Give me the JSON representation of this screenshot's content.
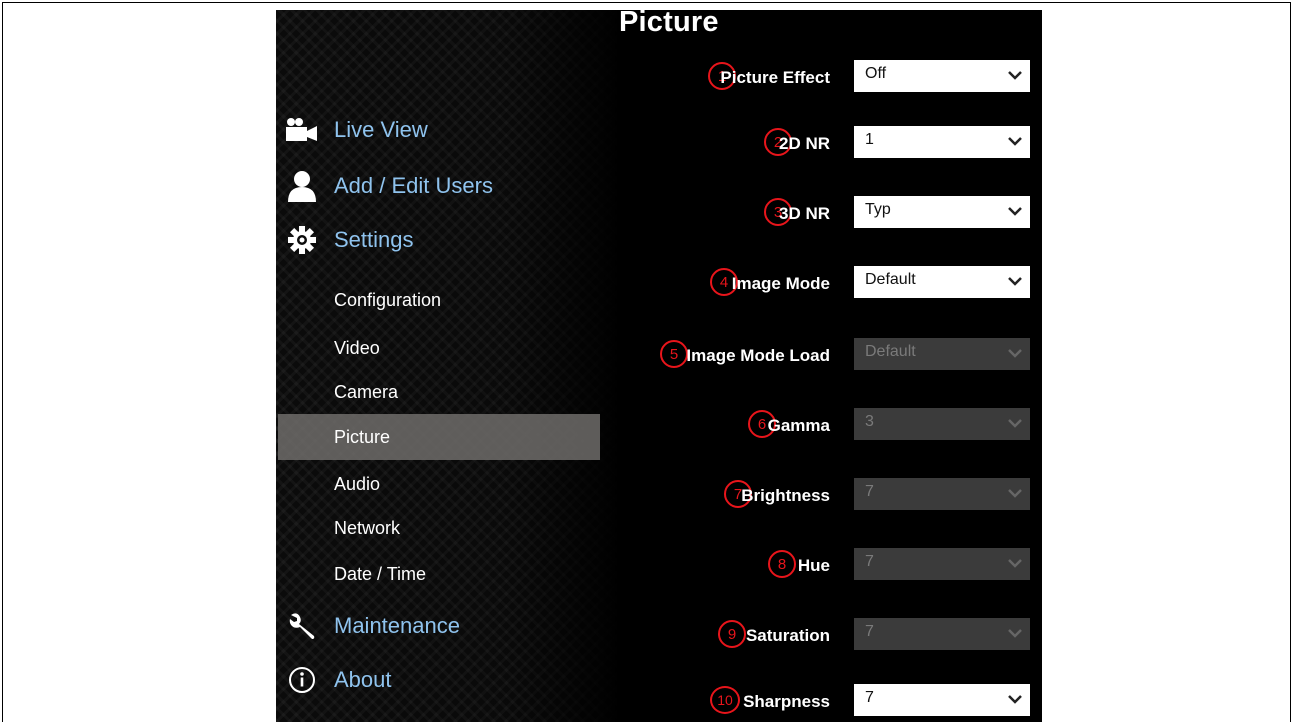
{
  "page": {
    "title": "Picture"
  },
  "nav": {
    "main": [
      {
        "label": "Live View",
        "icon": "video-camera-icon"
      },
      {
        "label": "Add / Edit Users",
        "icon": "user-icon"
      },
      {
        "label": "Settings",
        "icon": "gear-icon"
      },
      {
        "label": "Maintenance",
        "icon": "wrench-icon"
      },
      {
        "label": "About",
        "icon": "info-icon"
      }
    ],
    "settings_sub": [
      {
        "label": "Configuration"
      },
      {
        "label": "Video"
      },
      {
        "label": "Camera"
      },
      {
        "label": "Picture",
        "active": true
      },
      {
        "label": "Audio"
      },
      {
        "label": "Network"
      },
      {
        "label": "Date / Time"
      }
    ]
  },
  "fields": [
    {
      "num": "1",
      "label": "Picture Effect",
      "value": "Off",
      "disabled": false
    },
    {
      "num": "2",
      "label": "2D NR",
      "value": "1",
      "disabled": false
    },
    {
      "num": "3",
      "label": "3D NR",
      "value": "Typ",
      "disabled": false
    },
    {
      "num": "4",
      "label": "Image Mode",
      "value": "Default",
      "disabled": false
    },
    {
      "num": "5",
      "label": "Image Mode Load",
      "value": "Default",
      "disabled": true
    },
    {
      "num": "6",
      "label": "Gamma",
      "value": "3",
      "disabled": true
    },
    {
      "num": "7",
      "label": "Brightness",
      "value": "7",
      "disabled": true
    },
    {
      "num": "8",
      "label": "Hue",
      "value": "7",
      "disabled": true
    },
    {
      "num": "9",
      "label": "Saturation",
      "value": "7",
      "disabled": true
    },
    {
      "num": "10",
      "label": "Sharpness",
      "value": "7",
      "disabled": false
    }
  ],
  "colors": {
    "link": "#8fc3ee",
    "badge": "#e8151b",
    "panel": "#0b0b0b",
    "active_bg": "#6e6c6a"
  }
}
